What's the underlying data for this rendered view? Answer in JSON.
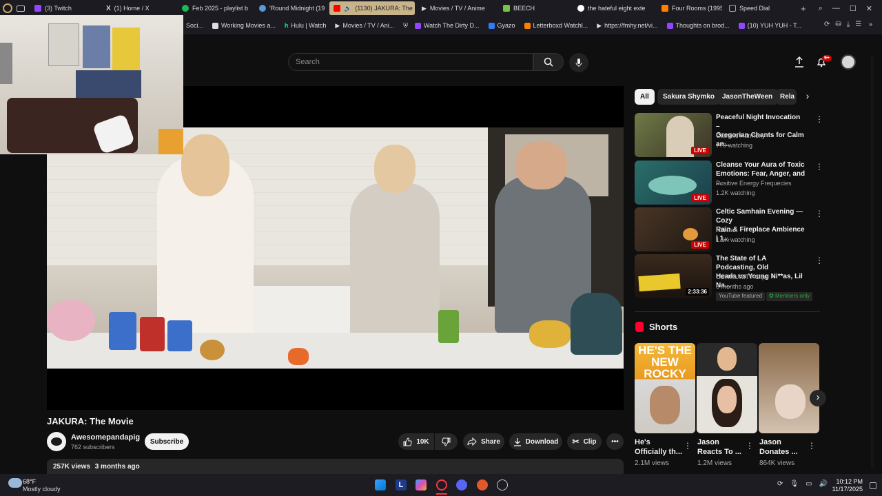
{
  "browser": {
    "tabs": [
      {
        "label": "(3) Twitch",
        "icon": "twitch-icon",
        "color": "#9146ff"
      },
      {
        "label": "(1) Home / X",
        "icon": "x-icon",
        "color": "#ffffff"
      },
      {
        "label": "Feb 2025 - playlist b",
        "icon": "spotify-icon",
        "color": "#1db954"
      },
      {
        "label": "'Round Midnight (19",
        "icon": "globe-icon",
        "color": "#5b9bd5"
      },
      {
        "label": "(1130) JAKURA: The M",
        "icon": "youtube-icon",
        "color": "#ff0000"
      },
      {
        "label": "Movies / TV / Anime",
        "icon": "play-icon",
        "color": "#ffffff"
      },
      {
        "label": "BEECH",
        "icon": "leaf-icon",
        "color": "#7bc142"
      },
      {
        "label": "the hateful eight exte",
        "icon": "google-icon",
        "color": "#4285f4"
      },
      {
        "label": "Four Rooms (1995)",
        "icon": "letterboxd-icon",
        "color": "#ff8000"
      },
      {
        "label": "Speed Dial",
        "icon": "speed-dial-icon",
        "color": "#aaaaaa"
      }
    ],
    "bookmarks": [
      {
        "label": "Soci...",
        "color": "#888888"
      },
      {
        "label": "Working Movies a...",
        "color": "#dddddd"
      },
      {
        "label": "Hulu | Watch",
        "color": "#1ce783"
      },
      {
        "label": "Movies / TV / Ani...",
        "color": "#ffffff"
      },
      {
        "label": "Watch The Dirty D...",
        "color": "#9146ff"
      },
      {
        "label": "Gyazo",
        "color": "#2e7cf6"
      },
      {
        "label": "Letterboxd Watchl...",
        "color": "#ff8000"
      },
      {
        "label": "https://fmhy.net/vi...",
        "color": "#ffffff"
      },
      {
        "label": "Thoughts on brod...",
        "color": "#9146ff"
      },
      {
        "label": "(10) YUH YUH - T...",
        "color": "#9146ff"
      }
    ]
  },
  "youtube": {
    "search_placeholder": "Search",
    "notification_count": "9+",
    "video": {
      "title": "JAKURA: The Movie",
      "channel": "Awesomepandapig",
      "subscribers": "762 subscribers",
      "subscribe_label": "Subscribe",
      "likes": "10K",
      "share_label": "Share",
      "download_label": "Download",
      "clip_label": "Clip",
      "views": "257K views",
      "age": "3 months ago"
    },
    "chips": [
      "All",
      "Sakura Shymko",
      "JasonTheWeen",
      "Rela"
    ],
    "recommendations": [
      {
        "title_line1": "Peaceful Night Invocation –",
        "title_line2": "Gregorian Chants for Calm an...",
        "channel": "Catholic Harmony",
        "meta": "779 watching",
        "badge": "LIVE"
      },
      {
        "title_line1": "Cleanse Your Aura of Toxic",
        "title_line2": "Emotions: Fear, Anger, and ...",
        "channel": "Positive Energy Frequecies",
        "meta": "1.2K watching",
        "badge": "LIVE"
      },
      {
        "title_line1": "Celtic Samhain Evening — Cozy",
        "title_line2": "Rain & Fireplace Ambience | 1...",
        "channel": "Naiara",
        "meta": "1.1K watching",
        "badge": "LIVE"
      },
      {
        "title_line1": "The State of LA Podcasting, Old",
        "title_line2": "Heads vs Young Ni**as, Lil Na...",
        "channel": "CUHMUNITY Clips",
        "meta": "6 months ago",
        "badge": "2:33:36",
        "tag1": "YouTube featured",
        "tag2": "Members only"
      }
    ],
    "shorts_heading": "Shorts",
    "shorts": [
      {
        "title_line1": "He's",
        "title_line2": "Officially th...",
        "views": "2.1M views",
        "overlay": "HE'S THE NEW ROCKY"
      },
      {
        "title_line1": "Jason",
        "title_line2": "Reacts To ...",
        "views": "1.2M views"
      },
      {
        "title_line1": "Jason",
        "title_line2": "Donates ...",
        "views": "864K views"
      }
    ]
  },
  "taskbar": {
    "weather_temp": "68°F",
    "weather_desc": "Mostly cloudy",
    "time": "10:12 PM",
    "date": "11/17/2025"
  }
}
